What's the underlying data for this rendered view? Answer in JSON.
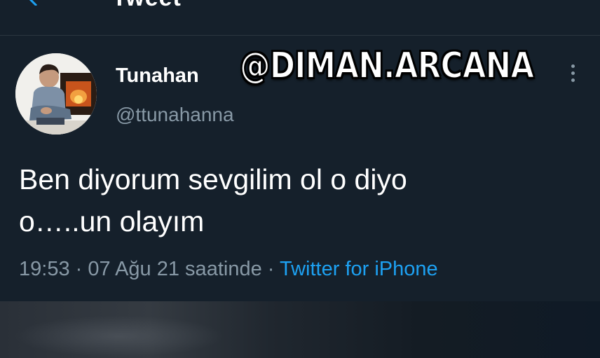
{
  "header": {
    "title": "Tweet",
    "back_icon": "arrow-left-icon"
  },
  "tweet": {
    "author_name": "Tunahan",
    "author_handle": "@ttunahanna",
    "watermark": "@DIMAN.ARCANA",
    "text_line1": "Ben diyorum sevgilim ol o diyo",
    "text_line2": "o…..un olayım",
    "time": "19:53",
    "separator": "·",
    "date": "07 Ağu 21 saatinde",
    "source": "Twitter for iPhone",
    "more_icon": "vertical-ellipsis-icon"
  },
  "colors": {
    "background": "#15202b",
    "accent": "#1da1f2",
    "secondary_text": "#8899a6",
    "primary_text": "#ffffff"
  }
}
